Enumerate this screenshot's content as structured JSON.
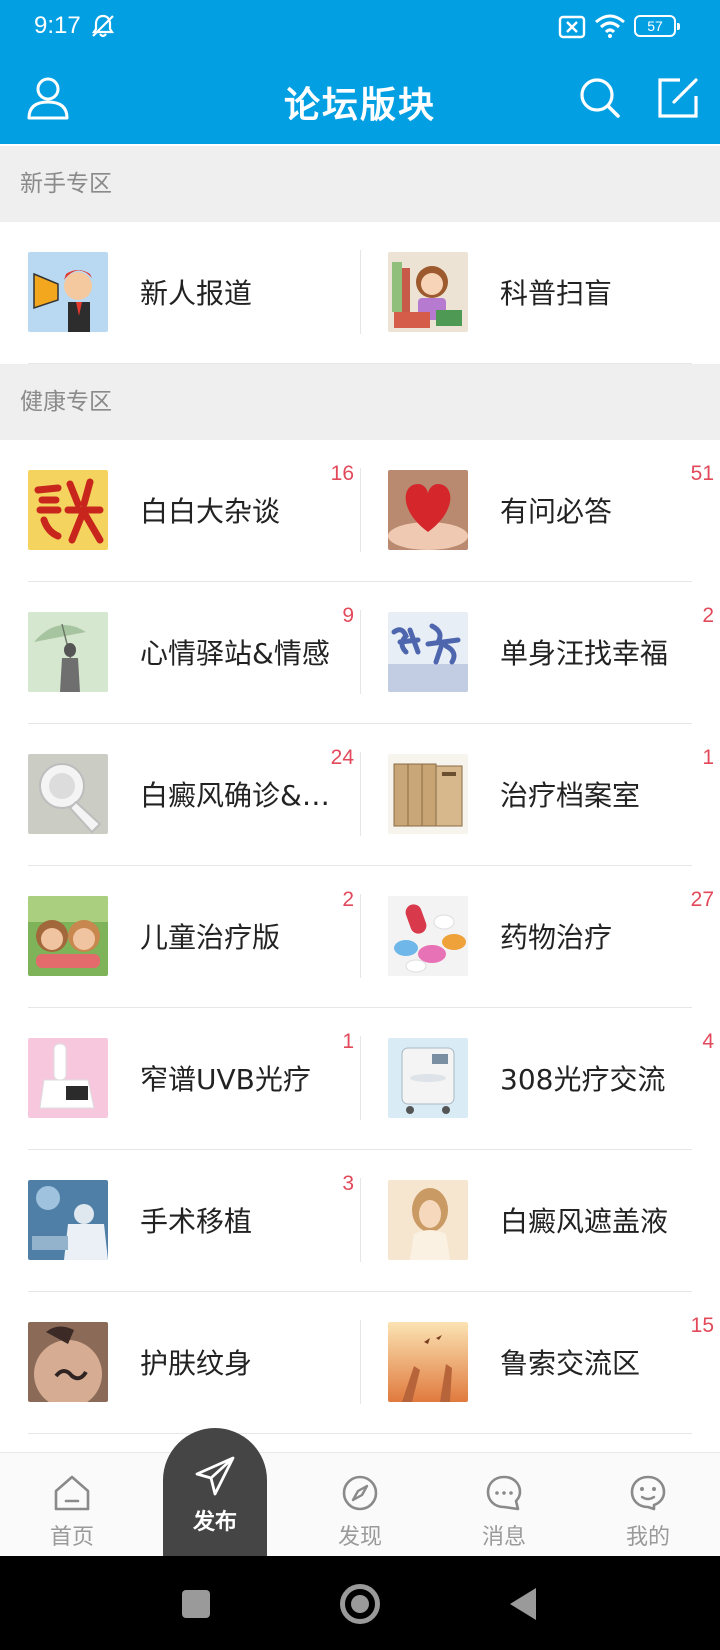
{
  "status": {
    "time": "9:17",
    "battery": "57"
  },
  "header": {
    "title": "论坛版块"
  },
  "sections": [
    {
      "title": "新手专区",
      "rows": [
        [
          {
            "name": "新人报道",
            "count": "",
            "thumb": "megaphone-avatar",
            "colors": [
              "#b9d9f3",
              "#f1c27d",
              "#e43a2f"
            ]
          },
          {
            "name": "科普扫盲",
            "count": "",
            "thumb": "girl-reading",
            "colors": [
              "#e9dcc9",
              "#f3b8a4",
              "#c87a4a"
            ]
          }
        ]
      ]
    },
    {
      "title": "健康专区",
      "rows": [
        [
          {
            "name": "白白大杂谈",
            "count": "16",
            "thumb": "red-calligraphy",
            "colors": [
              "#f4d45e",
              "#d62b1f",
              "#f0b338"
            ]
          },
          {
            "name": "有问必答",
            "count": "51",
            "thumb": "heart-in-hands",
            "colors": [
              "#d8a58a",
              "#d52b2f",
              "#f4d3bf"
            ]
          }
        ],
        [
          {
            "name": "心情驿站&情感",
            "count": "9",
            "thumb": "umbrella-girl",
            "colors": [
              "#d6e7cf",
              "#7f8c7c",
              "#b9cdb5"
            ]
          },
          {
            "name": "单身汪找幸福",
            "count": "2",
            "thumb": "fate-text",
            "colors": [
              "#eef3f8",
              "#5c77b8",
              "#c7d3e7"
            ]
          }
        ],
        [
          {
            "name": "白癜风确诊&症...",
            "count": "24",
            "thumb": "wood-lamp",
            "colors": [
              "#cfd1c9",
              "#f4f4f4",
              "#a9aca2"
            ]
          },
          {
            "name": "治疗档案室",
            "count": "1",
            "thumb": "folders",
            "colors": [
              "#f7f4ee",
              "#c8a57a",
              "#9a7a52"
            ]
          }
        ],
        [
          {
            "name": "儿童治疗版",
            "count": "2",
            "thumb": "children-grass",
            "colors": [
              "#7fb35a",
              "#e4b691",
              "#a26b3f"
            ]
          },
          {
            "name": "药物治疗",
            "count": "27",
            "thumb": "pills",
            "colors": [
              "#f5f5f5",
              "#e1495a",
              "#6fb6e9"
            ]
          }
        ],
        [
          {
            "name": "窄谱UVB光疗",
            "count": "1",
            "thumb": "uvb-device",
            "colors": [
              "#f7c7de",
              "#ffffff",
              "#2b2b2b"
            ]
          },
          {
            "name": "308光疗交流",
            "count": "4",
            "thumb": "laser-machine",
            "colors": [
              "#d9ecf6",
              "#f4f4f4",
              "#7a8fa2"
            ]
          }
        ],
        [
          {
            "name": "手术移植",
            "count": "3",
            "thumb": "surgery",
            "colors": [
              "#4f7fa7",
              "#dfe8ef",
              "#93b3cc"
            ]
          },
          {
            "name": "白癜风遮盖液",
            "count": "",
            "thumb": "woman-portrait",
            "colors": [
              "#f5e2c8",
              "#e0b88b",
              "#fbf1e3"
            ]
          }
        ],
        [
          {
            "name": "护肤纹身",
            "count": "",
            "thumb": "back-tattoo",
            "colors": [
              "#c99b7f",
              "#3b2a25",
              "#e1bfa7"
            ]
          },
          {
            "name": "鲁索交流区",
            "count": "15",
            "thumb": "hands-sunset",
            "colors": [
              "#f3b16a",
              "#e0844a",
              "#fbe3b3"
            ]
          }
        ]
      ]
    }
  ],
  "bottom_nav": {
    "home": "首页",
    "publish": "发布",
    "discover": "发现",
    "messages": "消息",
    "mine": "我的"
  },
  "icons": {
    "user": "user-icon",
    "search": "search-icon",
    "edit": "edit-icon",
    "home": "home-icon",
    "publish": "paper-plane-icon",
    "discover": "compass-icon",
    "messages": "chat-bubble-icon",
    "mine": "smiley-icon"
  },
  "accent": "#029fe3",
  "count_color": "#e24a5b"
}
